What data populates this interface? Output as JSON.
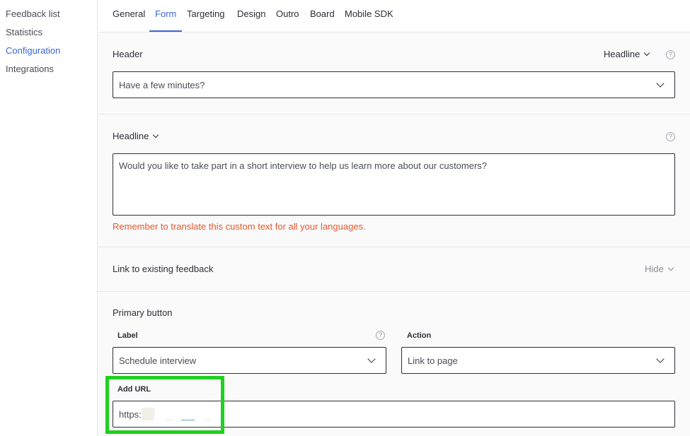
{
  "sidebar": {
    "items": [
      {
        "label": "Feedback list"
      },
      {
        "label": "Statistics"
      },
      {
        "label": "Configuration"
      },
      {
        "label": "Integrations"
      }
    ],
    "active_color": "#3a66d8"
  },
  "tabs": [
    {
      "label": "General"
    },
    {
      "label": "Form"
    },
    {
      "label": "Targeting"
    },
    {
      "label": "Design"
    },
    {
      "label": "Outro"
    },
    {
      "label": "Board"
    },
    {
      "label": "Mobile SDK"
    }
  ],
  "header_section": {
    "title": "Header",
    "type_selector": "Headline",
    "help": "?",
    "field_value": "Have a few minutes?"
  },
  "headline_section": {
    "title": "Headline",
    "help": "?",
    "text": "Would you like to take part in a short interview to help us learn more about our customers?",
    "warning": "Remember to translate this custom text for all your languages."
  },
  "link_section": {
    "title": "Link to existing feedback",
    "toggle": "Hide"
  },
  "primary_button_section": {
    "title": "Primary button",
    "label_title": "Label",
    "label_help": "?",
    "label_value": "Schedule interview",
    "action_title": "Action",
    "action_value": "Link to page",
    "url_title": "Add URL",
    "url_value": "https:"
  },
  "colors": {
    "accent": "#3a66d8",
    "warning": "#e8572c",
    "highlight": "#20d020"
  }
}
